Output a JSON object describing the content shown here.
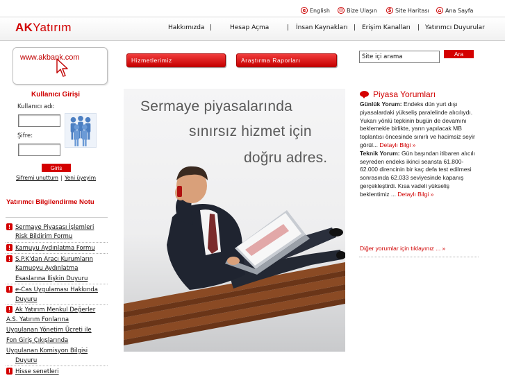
{
  "utility": {
    "english": "English",
    "contact": "Bize Ulaşın",
    "sitemap": "Site Haritası",
    "home": "Ana Sayfa"
  },
  "logo": {
    "ak": "AK",
    "yatirim": "Yatırım"
  },
  "nav": {
    "items": [
      "Hakkımızda",
      "Hesap Açma",
      "İnsan Kaynakları",
      "Erişim Kanalları",
      "Yatırımcı Duyurular"
    ],
    "separator": "|"
  },
  "akbank": {
    "url": "www.akbank.com"
  },
  "login": {
    "title": "Kullanıcı Girişi",
    "username_label": "Kullanıcı adı:",
    "password_label": "Şifre:",
    "submit": "Giris",
    "forgot": "Şifremi unuttum",
    "divider": "|",
    "register": "Yeni üyeyim"
  },
  "notices": {
    "title": "Yatırımcı Bilgilendirme Notu",
    "items": [
      {
        "line1": "Sermaye Piyasası İşlemleri",
        "line2": "Risk Bildirim Formu"
      },
      {
        "line1": "Kamuyu Aydınlatma Formu"
      },
      {
        "line1": "S.P.K'dan Aracı Kurumların",
        "line2": "Kamuoyu Aydınlatma",
        "line3": "Esaslarına İlişkin Duyuru"
      },
      {
        "line1": "e-Cas Uygulaması Hakkında",
        "line2": "Duyuru"
      },
      {
        "line1": "Ak Yatırım Menkul Değerler",
        "line2": "A.S. Yatırım Fonlarına",
        "line3": "Uygulanan Yönetim Ücreti ile",
        "line4": "Fon Giriş Çıkışlarında",
        "line5": "Uygulanan Komisyon Bilgisi",
        "line6": "Duyuru"
      },
      {
        "line1": "Hisse senetleri"
      }
    ]
  },
  "tabs": {
    "services": "Hizmetlerimiz",
    "reports": "Araştırma Raporları"
  },
  "hero": {
    "line1": "Sermaye piyasalarında",
    "line2": "sınırsız hizmet için",
    "line3": "doğru adres."
  },
  "search": {
    "placeholder": "Site içi arama",
    "button": "Ara"
  },
  "market": {
    "title": "Piyasa Yorumları",
    "daily_label": "Günlük Yorum:",
    "daily_text": "Endeks dün yurt dışı piyasalardaki yükseliş paralelinde alıcılıydı. Yukarı yönlü tepkinin bugün de devamını beklemekle birlikte, yarın yapılacak MB toplantısı öncesinde sınırlı ve hacimsiz seyir görül...",
    "daily_link": "Detaylı Bilgi »",
    "tech_label": "Teknik Yorum:",
    "tech_text": "Gün başından itibaren alıcılı seyreden endeks ikinci seansta 61.800-62.000 direncinin bir kaç defa test edilmesi sonrasında 62.033 seviyesinde kapanış gerçekleştirdi. Kısa vadeli yükseliş beklentimiz ...",
    "tech_link": "Detaylı Bilgi »",
    "other_link": "Diğer yorumlar için tıklayınız ... »"
  },
  "colors": {
    "brand_red": "#d00000",
    "text": "#222222"
  }
}
